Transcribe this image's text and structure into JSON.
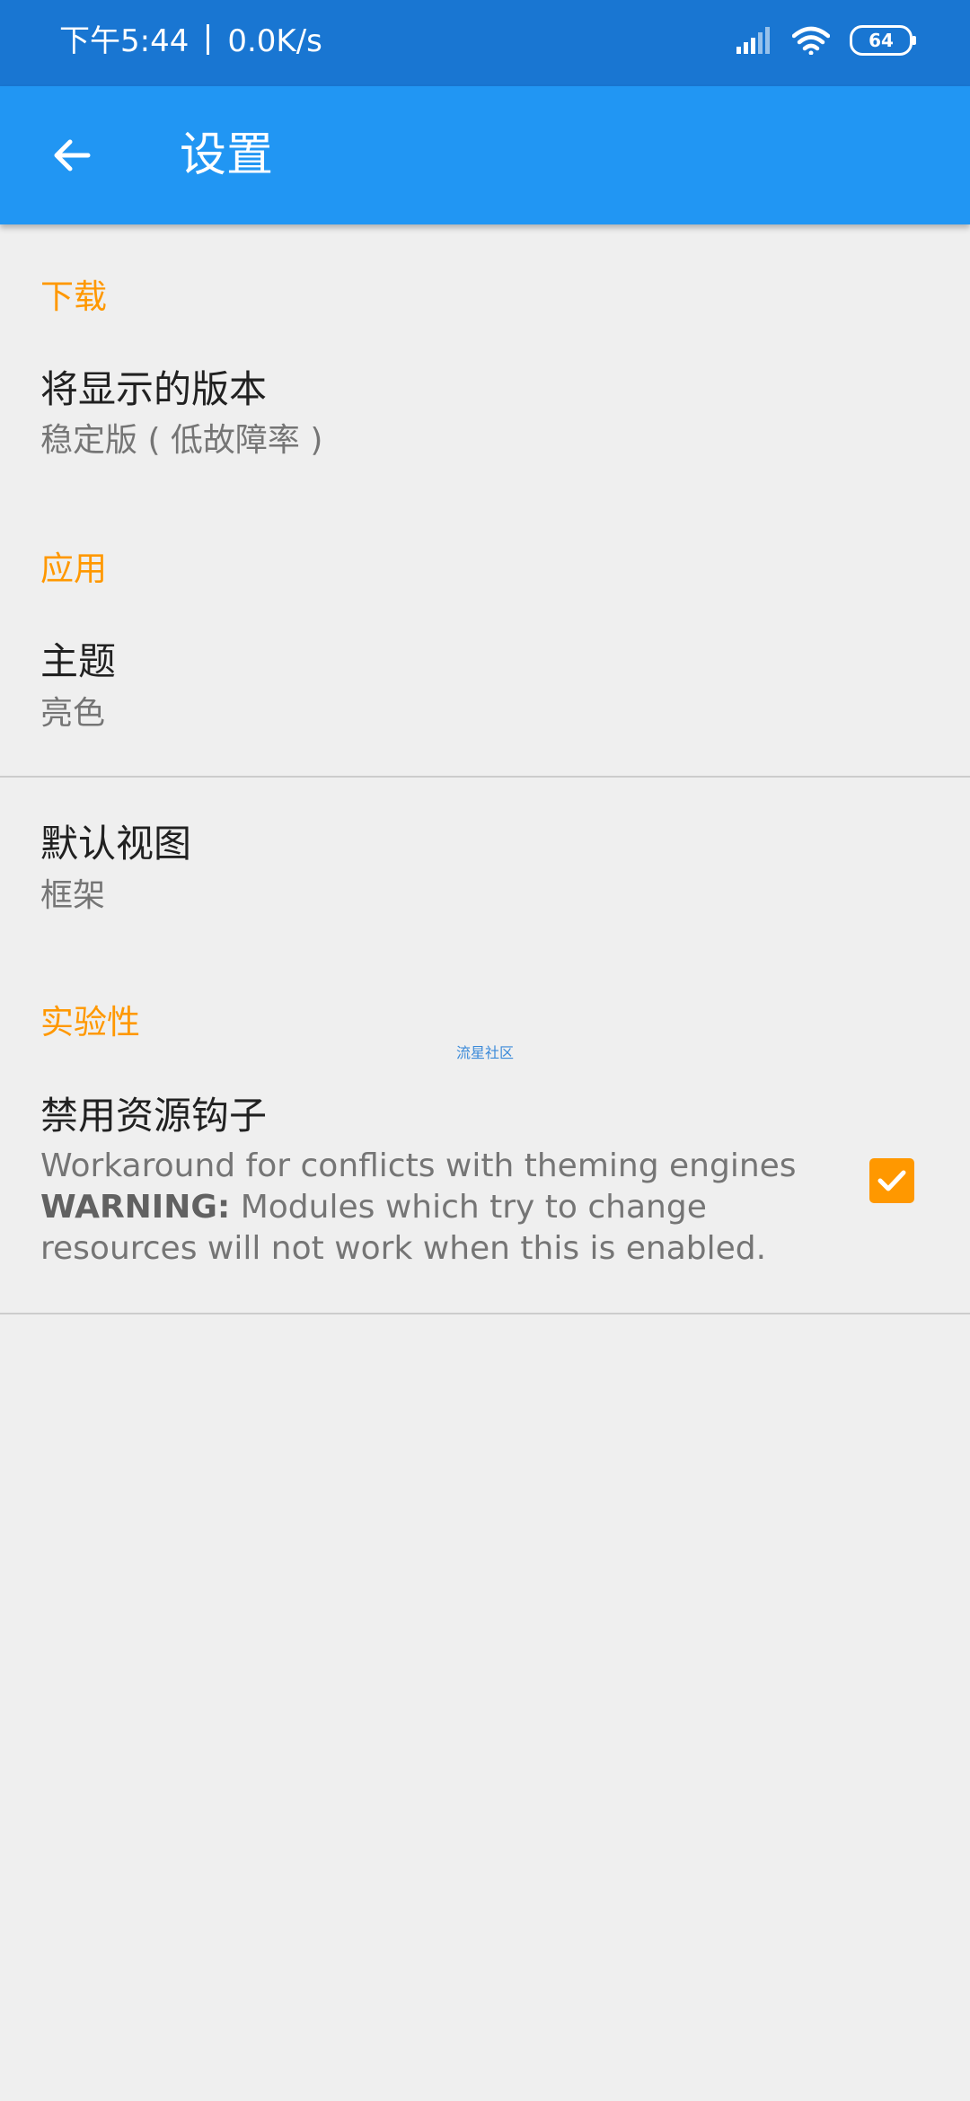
{
  "status_bar": {
    "time": "下午5:44",
    "net_speed": "0.0K/s",
    "battery_level": "64"
  },
  "app_bar": {
    "title": "设置",
    "back_icon": "arrow-left-icon"
  },
  "sections": {
    "download": {
      "header": "下载",
      "version_title": "将显示的版本",
      "version_summary": "稳定版 ( 低故障率 )"
    },
    "app": {
      "header": "应用",
      "theme_title": "主题",
      "theme_summary": "亮色",
      "default_view_title": "默认视图",
      "default_view_summary": "框架"
    },
    "experimental": {
      "header": "实验性",
      "disable_hooks_title": "禁用资源钩子",
      "disable_hooks_line1": "Workaround for conflicts with theming engines",
      "warning_label": "WARNING:",
      "warning_text": " Modules which try to change resources will not work when this is enabled.",
      "disable_hooks_checked": true
    }
  },
  "watermark": "流星社区",
  "colors": {
    "status_bar": "#1976d2",
    "app_bar": "#2196f3",
    "accent": "#ff9800",
    "background": "#efefef"
  }
}
